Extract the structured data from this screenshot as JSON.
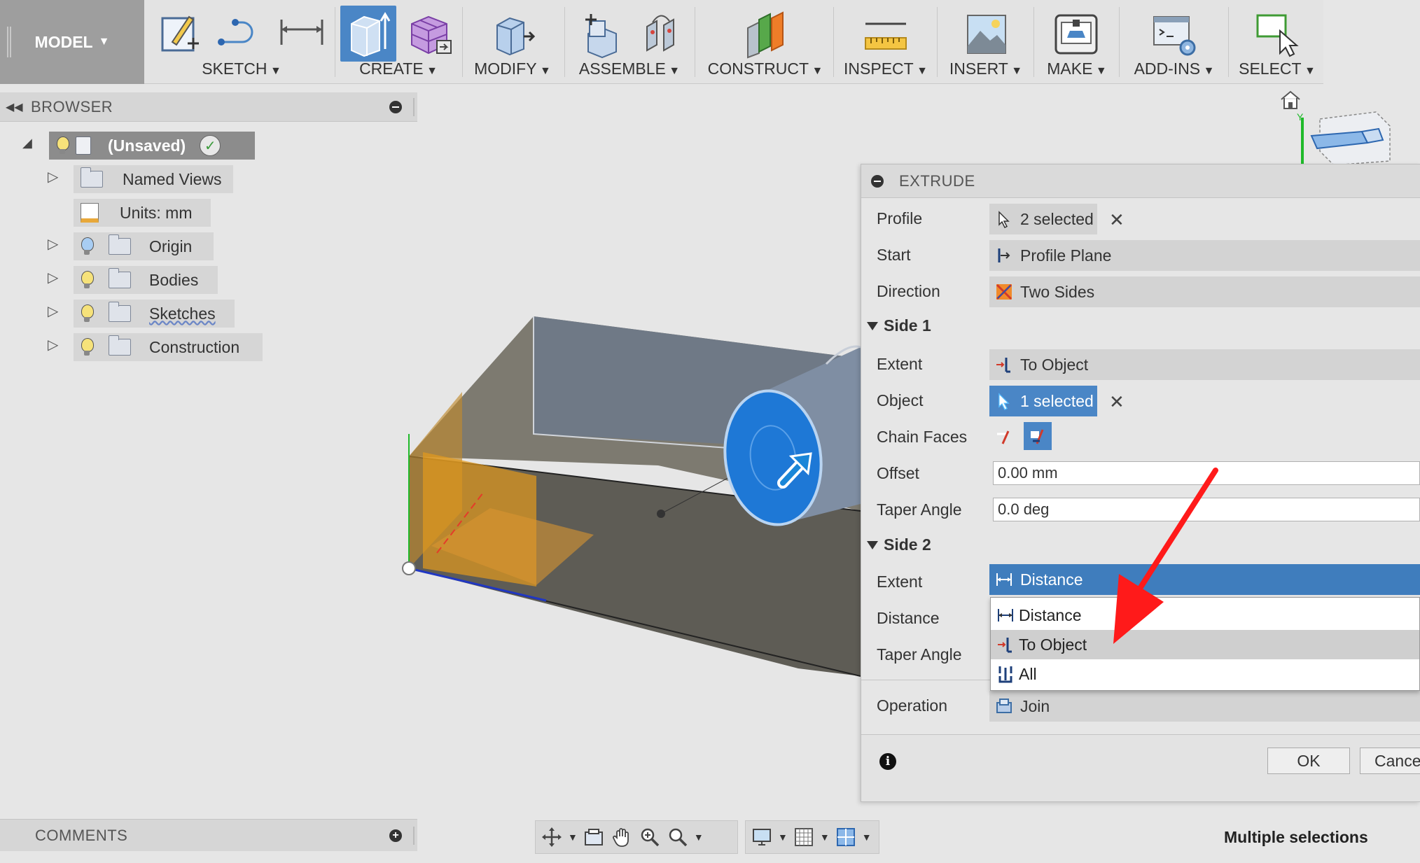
{
  "toolbar": {
    "workspace": "MODEL",
    "groups": [
      {
        "label": "SKETCH"
      },
      {
        "label": "CREATE"
      },
      {
        "label": "MODIFY"
      },
      {
        "label": "ASSEMBLE"
      },
      {
        "label": "CONSTRUCT"
      },
      {
        "label": "INSPECT"
      },
      {
        "label": "INSERT"
      },
      {
        "label": "MAKE"
      },
      {
        "label": "ADD-INS"
      },
      {
        "label": "SELECT"
      }
    ]
  },
  "browser": {
    "title": "BROWSER",
    "root": "(Unsaved)",
    "items": [
      {
        "label": "Named Views"
      },
      {
        "label": "Units: mm"
      },
      {
        "label": "Origin"
      },
      {
        "label": "Bodies"
      },
      {
        "label": "Sketches"
      },
      {
        "label": "Construction"
      }
    ]
  },
  "comments": {
    "title": "COMMENTS"
  },
  "extrude": {
    "title": "EXTRUDE",
    "profile_label": "Profile",
    "profile_value": "2 selected",
    "start_label": "Start",
    "start_value": "Profile Plane",
    "direction_label": "Direction",
    "direction_value": "Two Sides",
    "side1": {
      "title": "Side 1",
      "extent_label": "Extent",
      "extent_value": "To Object",
      "object_label": "Object",
      "object_value": "1 selected",
      "chain_label": "Chain Faces",
      "offset_label": "Offset",
      "offset_value": "0.00 mm",
      "taper_label": "Taper Angle",
      "taper_value": "0.0 deg"
    },
    "side2": {
      "title": "Side 2",
      "extent_label": "Extent",
      "extent_value": "Distance",
      "distance_label": "Distance",
      "taper_label": "Taper Angle",
      "options": [
        "Distance",
        "To Object",
        "All"
      ]
    },
    "operation_label": "Operation",
    "operation_value": "Join",
    "ok_label": "OK",
    "cancel_label": "Cance"
  },
  "status": "Multiple selections",
  "colors": {
    "accent": "#4a86c6",
    "annotation_arrow": "#ff1a1a",
    "body": "#6b6a63",
    "sketch_profile": "#e29a1c"
  }
}
